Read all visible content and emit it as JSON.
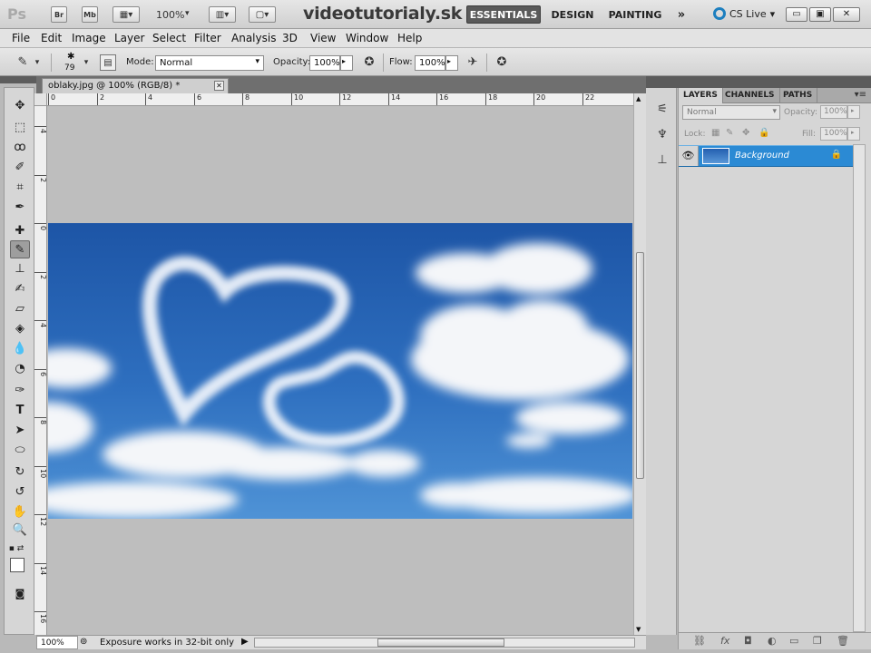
{
  "appbar": {
    "logo": "Ps",
    "bridge_label": "Br",
    "minibridge_label": "Mb",
    "zoom_value": "100%",
    "watermark": "videotutorialy.sk",
    "workspaces": [
      "ESSENTIALS",
      "DESIGN",
      "PAINTING"
    ],
    "more": "»",
    "cslive": "CS Live",
    "window_buttons": [
      "▭",
      "▣",
      "✕"
    ]
  },
  "menubar": {
    "items": [
      "File",
      "Edit",
      "Image",
      "Layer",
      "Select",
      "Filter",
      "Analysis",
      "3D",
      "View",
      "Window",
      "Help"
    ]
  },
  "options": {
    "brush_size": "79",
    "mode_label": "Mode:",
    "mode_value": "Normal",
    "opacity_label": "Opacity:",
    "opacity_value": "100%",
    "flow_label": "Flow:",
    "flow_value": "100%"
  },
  "document": {
    "tab_title": "oblaky.jpg @ 100% (RGB/8) *",
    "ruler_h": [
      "0",
      "2",
      "4",
      "6",
      "8",
      "10",
      "12",
      "14",
      "16",
      "18",
      "20",
      "22"
    ],
    "ruler_v": [
      "4",
      "2",
      "0",
      "2",
      "4",
      "6",
      "8",
      "10",
      "12",
      "14",
      "16"
    ]
  },
  "status": {
    "zoom": "100%",
    "info": "Exposure works in 32-bit only"
  },
  "layers_panel": {
    "tabs": [
      "LAYERS",
      "CHANNELS",
      "PATHS"
    ],
    "blend_mode": "Normal",
    "opacity_label": "Opacity:",
    "opacity_value": "100%",
    "lock_label": "Lock:",
    "fill_label": "Fill:",
    "fill_value": "100%",
    "layer_name": "Background"
  }
}
